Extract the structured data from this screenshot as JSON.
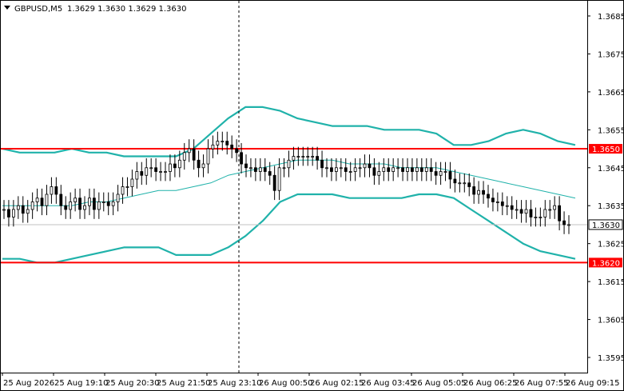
{
  "header": {
    "symbol_label": "GBPUSD,M5",
    "ohlc_label": "1.3629 1.3630 1.3629 1.3630"
  },
  "colors": {
    "background": "#ffffff",
    "frame": "#000000",
    "candle": "#000000",
    "bollinger": "#20b2aa",
    "level_line": "#ff0000",
    "level_tag_bg": "#ff0000",
    "price_tag_bg": "#ffffff",
    "vertical_dashed": "#000000",
    "bid_line": "#c0c0c0"
  },
  "chart_data": {
    "type": "candlestick",
    "symbol": "GBPUSD",
    "timeframe": "M5",
    "ylim": [
      1.3591,
      1.3689
    ],
    "y_ticks": [
      "1.3685",
      "1.3675",
      "1.3665",
      "1.3655",
      "1.3645",
      "1.3635",
      "1.3625",
      "1.3615",
      "1.3605",
      "1.3595"
    ],
    "x_ticks": [
      "25 Aug 2026",
      "25 Aug 19:10",
      "25 Aug 20:30",
      "25 Aug 21:50",
      "25 Aug 23:10",
      "26 Aug 00:50",
      "26 Aug 02:15",
      "26 Aug 03:45",
      "26 Aug 05:05",
      "26 Aug 06:25",
      "26 Aug 07:55",
      "26 Aug 09:15"
    ],
    "horizontal_levels": [
      {
        "price": 1.365,
        "label": "1.3650"
      },
      {
        "price": 1.362,
        "label": "1.3620"
      }
    ],
    "current_price": {
      "price": 1.363,
      "label": "1.3630"
    },
    "candles_close": [
      1.3634,
      1.3632,
      1.3634,
      1.3635,
      1.3633,
      1.3634,
      1.3636,
      1.3637,
      1.3635,
      1.3638,
      1.364,
      1.3638,
      1.3635,
      1.3634,
      1.3636,
      1.3637,
      1.3634,
      1.3635,
      1.3637,
      1.3634,
      1.3636,
      1.3636,
      1.3635,
      1.3636,
      1.3638,
      1.364,
      1.364,
      1.3642,
      1.3644,
      1.3643,
      1.3645,
      1.3645,
      1.3644,
      1.3644,
      1.3644,
      1.3646,
      1.3645,
      1.3647,
      1.3649,
      1.365,
      1.3647,
      1.3645,
      1.3646,
      1.365,
      1.3651,
      1.3652,
      1.3652,
      1.3651,
      1.365,
      1.3649,
      1.3646,
      1.3645,
      1.3645,
      1.3644,
      1.3645,
      1.3644,
      1.3643,
      1.3639,
      1.3645,
      1.3645,
      1.3647,
      1.3648,
      1.3648,
      1.3648,
      1.3648,
      1.3648,
      1.3647,
      1.3645,
      1.3645,
      1.3644,
      1.3645,
      1.3645,
      1.3644,
      1.3644,
      1.3645,
      1.3645,
      1.3646,
      1.3645,
      1.3643,
      1.3644,
      1.3645,
      1.3644,
      1.3645,
      1.3645,
      1.3644,
      1.3645,
      1.3644,
      1.3645,
      1.3644,
      1.3645,
      1.3644,
      1.3643,
      1.3644,
      1.3644,
      1.3642,
      1.3641,
      1.3641,
      1.3641,
      1.364,
      1.3638,
      1.3639,
      1.3638,
      1.3637,
      1.3636,
      1.3636,
      1.3635,
      1.3635,
      1.3634,
      1.3634,
      1.3633,
      1.3634,
      1.3632,
      1.3632,
      1.3632,
      1.3634,
      1.3634,
      1.3635,
      1.3631,
      1.363,
      1.363
    ],
    "bollinger": {
      "period_note": "",
      "upper": [
        1.365,
        1.3649,
        1.3649,
        1.3649,
        1.365,
        1.3649,
        1.3649,
        1.3648,
        1.3648,
        1.3648,
        1.3648,
        1.365,
        1.3654,
        1.3658,
        1.3661,
        1.3661,
        1.366,
        1.3658,
        1.3657,
        1.3656,
        1.3656,
        1.3656,
        1.3655,
        1.3655,
        1.3655,
        1.3654,
        1.3651,
        1.3651,
        1.3652,
        1.3654,
        1.3655,
        1.3654,
        1.3652,
        1.3651
      ],
      "middle": [
        1.3635,
        1.3635,
        1.3635,
        1.3635,
        1.3635,
        1.3636,
        1.3636,
        1.3637,
        1.3638,
        1.3639,
        1.3639,
        1.364,
        1.3641,
        1.3643,
        1.3644,
        1.3645,
        1.3646,
        1.3647,
        1.3647,
        1.3647,
        1.3646,
        1.3646,
        1.3646,
        1.3645,
        1.3645,
        1.3645,
        1.3644,
        1.3643,
        1.3642,
        1.3641,
        1.364,
        1.3639,
        1.3638,
        1.3637
      ],
      "lower": [
        1.3621,
        1.3621,
        1.362,
        1.362,
        1.3621,
        1.3622,
        1.3623,
        1.3624,
        1.3624,
        1.3624,
        1.3622,
        1.3622,
        1.3622,
        1.3624,
        1.3627,
        1.3631,
        1.3636,
        1.3638,
        1.3638,
        1.3638,
        1.3637,
        1.3637,
        1.3637,
        1.3637,
        1.3638,
        1.3638,
        1.3637,
        1.3634,
        1.3631,
        1.3628,
        1.3625,
        1.3623,
        1.3622,
        1.3621
      ]
    }
  }
}
